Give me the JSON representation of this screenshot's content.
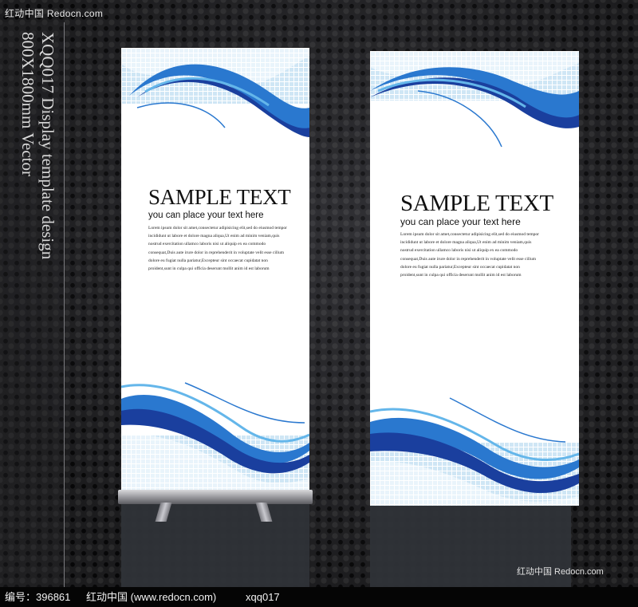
{
  "watermark_top": "红动中国 Redocn.com",
  "vertical_title": {
    "line1": "XQQ017 Display template design",
    "line2": "800X1800mm Vector"
  },
  "banners": {
    "left": {
      "title": "SAMPLE TEXT",
      "subtitle": "you can place your text here",
      "body_lines": [
        "Lorem ipsum dolor sit amet,consectetur adipisicing elit,sed do eiusmod tempor",
        "incididunt ut labore et dolore magna aliqua,Ut enim ad minim veniam,quis",
        "nostrud exercitation ullamco laboris nisi ut aliquip ex ea commodo",
        "consequat,Duis aute irure dolor in reprehenderit in voluptate velit esse cillum",
        "dolore eu fugiat nulla pariatur,Excepteur sint occaecat cupidatat non",
        "proident,sunt in culpa qui officia deserunt mollit anim id est laborum"
      ]
    },
    "right": {
      "title": "SAMPLE TEXT",
      "subtitle": "you can place your text here",
      "body_lines": [
        "Lorem ipsum dolor sit amet,consectetur adipisicing elit,sed do eiusmod tempor",
        "incididunt ut labore et dolore magna aliqua,Ut enim ad minim veniam,quis",
        "nostrud exercitation ullamco laboris nisi ut aliquip ex ea commodo",
        "consequat,Duis aute irure dolor in reprehenderit in voluptate velit esse cillum",
        "dolore eu fugiat nulla pariatur,Excepteur sint occaecat cupidatat non",
        "proident,sunt in culpa qui officia deserunt mollit anim id est laborum"
      ]
    }
  },
  "watermark_bottom": "红动中国 Redocn.com",
  "footer": {
    "id_label": "编号：396861",
    "site": "红动中国 (www.redocn.com)",
    "code": "xqq017"
  },
  "colors": {
    "wave_dark": "#1a3f9e",
    "wave_mid": "#2a78cf",
    "wave_light": "#64b6ea",
    "grid_light": "#cfe6f5"
  }
}
